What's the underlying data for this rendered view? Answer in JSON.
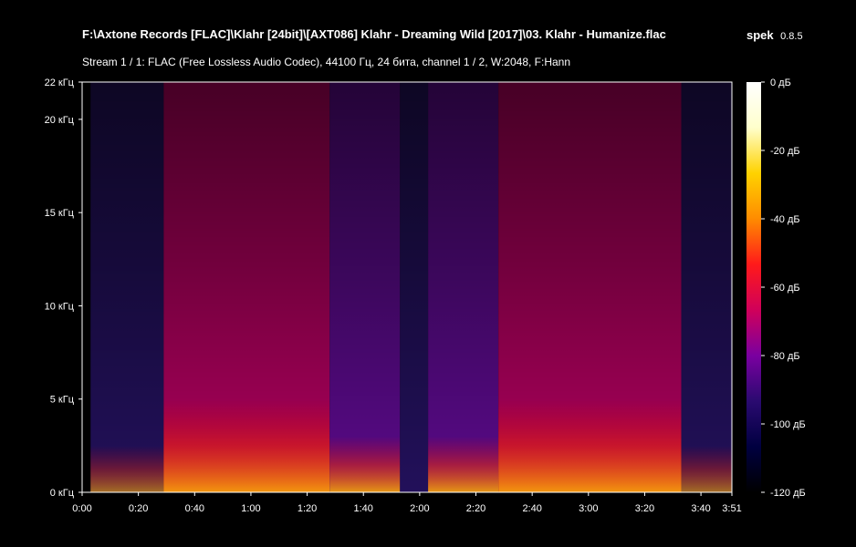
{
  "header": {
    "file_path": "F:\\Axtone Records [FLAC]\\Klahr [24bit]\\[AXT086] Klahr - Dreaming Wild [2017]\\03. Klahr - Humanize.flac",
    "stream_info": "Stream 1 / 1: FLAC (Free Lossless Audio Codec), 44100 Гц, 24 бита, channel 1 / 2, W:2048, F:Hann",
    "app_name": "spek",
    "app_version": "0.8.5"
  },
  "colors": {
    "background": "#000000",
    "axis": "#ffffff",
    "scale": [
      "#000000",
      "#000040",
      "#2a0a70",
      "#7a00a0",
      "#d0005a",
      "#ff1a1a",
      "#ff8c00",
      "#ffd200",
      "#ffffcc",
      "#ffffff"
    ]
  },
  "chart_data": {
    "type": "heatmap",
    "title": "F:\\Axtone Records [FLAC]\\Klahr [24bit]\\[AXT086] Klahr - Dreaming Wild [2017]\\03. Klahr - Humanize.flac",
    "xlabel": "",
    "ylabel": "",
    "x_range_seconds": [
      0,
      231
    ],
    "y_range_khz": [
      0,
      22
    ],
    "x_ticks": [
      "0:00",
      "0:20",
      "0:40",
      "1:00",
      "1:20",
      "1:40",
      "2:00",
      "2:20",
      "2:40",
      "3:00",
      "3:20",
      "3:40",
      "3:51"
    ],
    "x_tick_seconds": [
      0,
      20,
      40,
      60,
      80,
      100,
      120,
      140,
      160,
      180,
      200,
      220,
      231
    ],
    "y_ticks": [
      "0 кГц",
      "5 кГц",
      "10 кГц",
      "15 кГц",
      "20 кГц",
      "22 кГц"
    ],
    "y_tick_khz": [
      0,
      5,
      10,
      15,
      20,
      22
    ],
    "colorbar_labels": [
      "0 дБ",
      "-20 дБ",
      "-40 дБ",
      "-60 дБ",
      "-80 дБ",
      "-100 дБ",
      "-120 дБ"
    ],
    "colorbar_db": [
      0,
      -20,
      -40,
      -60,
      -80,
      -100,
      -120
    ],
    "segments": [
      {
        "start": 0,
        "end": 3,
        "level": "silent"
      },
      {
        "start": 3,
        "end": 29,
        "level": "quiet"
      },
      {
        "start": 29,
        "end": 88,
        "level": "loud"
      },
      {
        "start": 88,
        "end": 113,
        "level": "medium"
      },
      {
        "start": 113,
        "end": 123,
        "level": "quiet"
      },
      {
        "start": 123,
        "end": 148,
        "level": "medium"
      },
      {
        "start": 148,
        "end": 213,
        "level": "loud"
      },
      {
        "start": 213,
        "end": 231,
        "level": "quiet"
      }
    ]
  }
}
